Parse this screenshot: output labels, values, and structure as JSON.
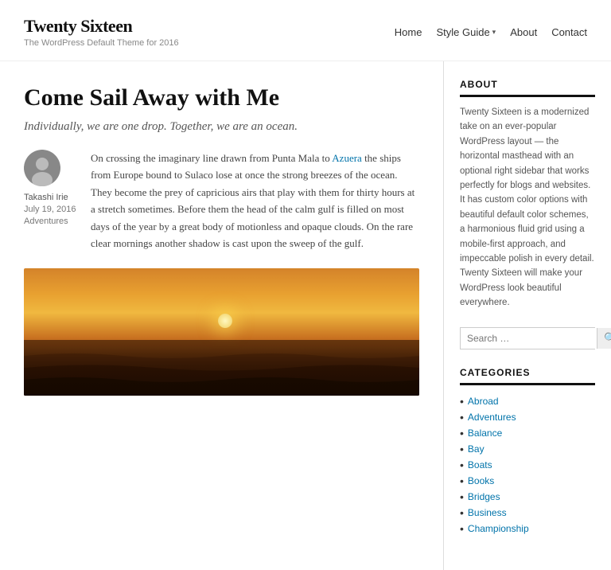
{
  "site": {
    "title": "Twenty Sixteen",
    "description": "The WordPress Default Theme for 2016"
  },
  "nav": {
    "items": [
      {
        "label": "Home",
        "has_dropdown": false
      },
      {
        "label": "Style Guide",
        "has_dropdown": true
      },
      {
        "label": "About",
        "has_dropdown": false
      },
      {
        "label": "Contact",
        "has_dropdown": false
      }
    ]
  },
  "post": {
    "title": "Come Sail Away with Me",
    "subtitle": "Individually, we are one drop. Together, we are an ocean.",
    "author": "Takashi Irie",
    "date": "July 19, 2016",
    "category": "Adventures",
    "link_text": "Azuera",
    "body": "On crossing the imaginary line drawn from Punta Mala to Azuera the ships from Europe bound to Sulaco lose at once the strong breezes of the ocean. They become the prey of capricious airs that play with them for thirty hours at a stretch sometimes. Before them the head of the calm gulf is filled on most days of the year by a great body of motionless and opaque clouds. On the rare clear mornings another shadow is cast upon the sweep of the gulf."
  },
  "sidebar": {
    "about": {
      "title": "ABOUT",
      "text": "Twenty Sixteen is a modernized take on an ever-popular WordPress layout — the horizontal masthead with an optional right sidebar that works perfectly for blogs and websites. It has custom color options with beautiful default color schemes, a harmonious fluid grid using a mobile-first approach, and impeccable polish in every detail. Twenty Sixteen will make your WordPress look beautiful everywhere."
    },
    "search": {
      "placeholder": "Search …",
      "button_icon": "🔍"
    },
    "categories": {
      "title": "CATEGORIES",
      "items": [
        {
          "label": "Abroad"
        },
        {
          "label": "Adventures"
        },
        {
          "label": "Balance"
        },
        {
          "label": "Bay"
        },
        {
          "label": "Boats"
        },
        {
          "label": "Books"
        },
        {
          "label": "Bridges"
        },
        {
          "label": "Business"
        },
        {
          "label": "Championship"
        }
      ]
    }
  }
}
